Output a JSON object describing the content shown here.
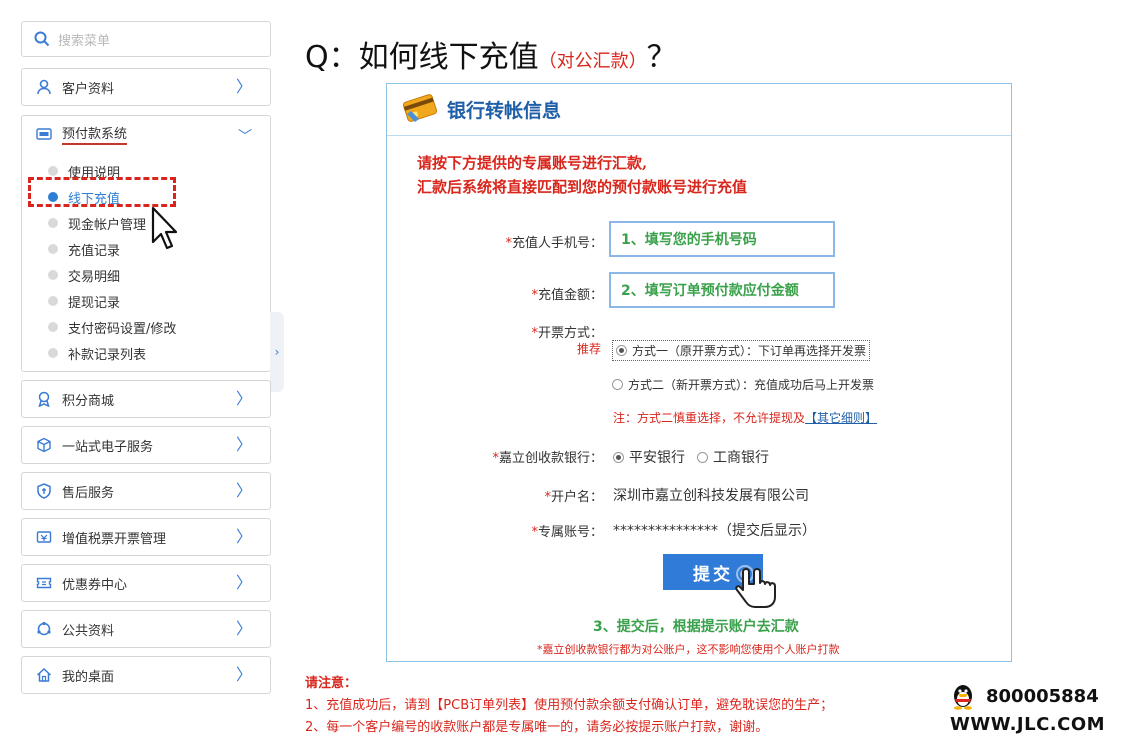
{
  "sidebar": {
    "search_placeholder": "搜索菜单",
    "customer_label": "客户资料",
    "prepay": {
      "label": "预付款系统",
      "icon_text": "预付",
      "items": [
        {
          "label": "使用说明"
        },
        {
          "label": "线下充值",
          "active": true
        },
        {
          "label": "现金帐户管理"
        },
        {
          "label": "充值记录"
        },
        {
          "label": "交易明细"
        },
        {
          "label": "提现记录"
        },
        {
          "label": "支付密码设置/修改"
        },
        {
          "label": "补款记录列表"
        }
      ]
    },
    "items_below": [
      {
        "label": "积分商城",
        "icon": "medal-icon"
      },
      {
        "label": "一站式电子服务",
        "icon": "box-icon"
      },
      {
        "label": "售后服务",
        "icon": "shield-icon"
      },
      {
        "label": "增值税票开票管理",
        "icon": "invoice-icon"
      },
      {
        "label": "优惠券中心",
        "icon": "coupon-icon"
      },
      {
        "label": "公共资料",
        "icon": "cycle-icon"
      },
      {
        "label": "我的桌面",
        "icon": "home-icon"
      }
    ]
  },
  "heading": {
    "q": "Q：如何线下充值",
    "sub": "（对公汇款）",
    "tail": "？"
  },
  "panel": {
    "title": "银行转帐信息",
    "notice_1": "请按下方提供的专属账号进行汇款,",
    "notice_2": "汇款后系统将直接匹配到您的预付款账号进行充值",
    "phone_label": "充值人手机号：",
    "phone_value": "1、填写您的手机号码",
    "amount_label": "充值金额：",
    "amount_value": "2、填写订单预付款应付金额",
    "invoice_label": "开票方式：",
    "recommend": "推荐",
    "invoice_opt1": "方式一（原开票方式）：下订单再选择开发票",
    "invoice_opt2": "方式二（新开票方式）：充值成功后马上开发票",
    "invoice_note": "注：方式二慎重选择，不允许提现及",
    "invoice_note_link": "【其它细则】",
    "bank_label": "嘉立创收款银行：",
    "bank_opt1": "平安银行",
    "bank_opt2": "工商银行",
    "holder_label": "开户名：",
    "holder_value": "深圳市嘉立创科技发展有限公司",
    "account_label": "专属账号：",
    "account_value": "***************（提交后显示）",
    "submit_label": "提交",
    "step3": "3、提交后，根据提示账户去汇款",
    "footnote": "*嘉立创收款银行都为对公账户，这不影响您使用个人账户打款"
  },
  "bottom": {
    "title": "请注意：",
    "line1": "1、充值成功后，请到【PCB订单列表】使用预付款余额支付确认订单，避免耽误您的生产；",
    "line2": "2、每一个客户编号的收款账户都是专属唯一的，请务必按提示账户打款，谢谢。"
  },
  "contact": {
    "phone": "800005884",
    "site": "WWW.JLC.COM"
  }
}
